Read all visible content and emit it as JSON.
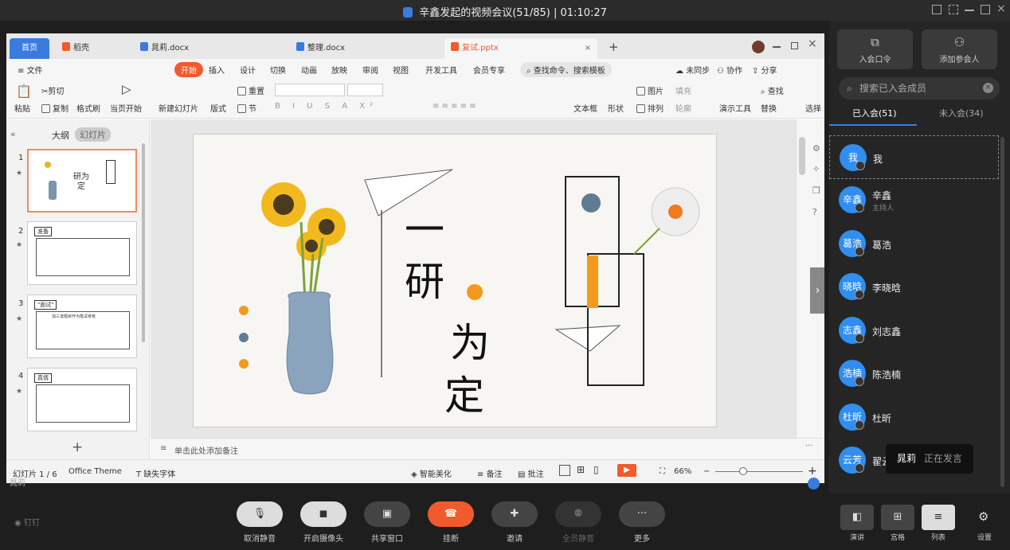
{
  "window": {
    "title": "辛鑫发起的视频会议(51/85)",
    "timer": "01:10:27"
  },
  "wps": {
    "tabs": [
      {
        "label": "首页"
      },
      {
        "label": "稻壳"
      },
      {
        "label": "晁莉.docx"
      },
      {
        "label": "整理.docx"
      },
      {
        "label": "复试.pptx"
      }
    ],
    "menu": [
      "文件",
      "开始",
      "插入",
      "设计",
      "切换",
      "动画",
      "放映",
      "审阅",
      "视图",
      "开发工具",
      "会员专享"
    ],
    "menu_search": "查找命令、搜索模板",
    "menu_right": [
      "未同步",
      "协作",
      "分享"
    ],
    "ribbon": {
      "paste": "粘贴",
      "cut": "剪切",
      "copy": "复制",
      "format_painter": "格式刷",
      "from_start": "当页开始",
      "new_slide": "新建幻灯片",
      "layout": "版式",
      "section": "节",
      "reset": "重置",
      "textbox": "文本框",
      "shape": "形状",
      "arrange": "排列",
      "picture": "图片",
      "fill": "填充",
      "outline": "轮廓",
      "presenter": "演示工具",
      "find": "查找",
      "replace": "替换",
      "select": "选择"
    },
    "panel_tabs": {
      "outline": "大纲",
      "slides": "幻灯片"
    },
    "notes_placeholder": "单击此处添加备注",
    "status": {
      "slide_count": "幻灯片 1 / 6",
      "theme": "Office Theme",
      "missing_font": "缺失字体",
      "beautify": "智能美化",
      "notes": "备注",
      "comment": "批注",
      "zoom": "66%"
    },
    "slides": [
      {
        "num": "1",
        "title": "研为定"
      },
      {
        "num": "2",
        "title": "准备"
      },
      {
        "num": "3",
        "title": "\"面试\"",
        "sub": "加三道题目作为笔试考核"
      },
      {
        "num": "4",
        "title": "真情"
      }
    ],
    "slide_text": {
      "c1": "一",
      "c2": "研",
      "c3": "为",
      "c4": "定"
    }
  },
  "sidebar": {
    "join_link": "入会口令",
    "add_member": "添加参会人",
    "search_placeholder": "搜索已入会成员",
    "tab_joined": "已入会(51)",
    "tab_not_joined": "未入会(34)",
    "members": [
      {
        "avatar": "我",
        "name": "我",
        "role": ""
      },
      {
        "avatar": "辛鑫",
        "name": "辛鑫",
        "role": "主持人"
      },
      {
        "avatar": "葛浩",
        "name": "葛浩",
        "role": ""
      },
      {
        "avatar": "晓晗",
        "name": "李晓晗",
        "role": ""
      },
      {
        "avatar": "志鑫",
        "name": "刘志鑫",
        "role": ""
      },
      {
        "avatar": "浩楠",
        "name": "陈浩楠",
        "role": ""
      },
      {
        "avatar": "杜昕",
        "name": "杜昕",
        "role": ""
      },
      {
        "avatar": "云芳",
        "name": "翟云",
        "role": ""
      }
    ],
    "speaking_name": "晁莉",
    "speaking_status": "正在发言"
  },
  "toolbar": {
    "presenter_name": "晁莉",
    "brand": "钉钉",
    "unmute": "取消静音",
    "camera": "开启摄像头",
    "share": "共享窗口",
    "hangup": "挂断",
    "invite": "邀请",
    "mute_all": "全员静音",
    "more": "更多",
    "views": [
      "演讲",
      "宫格",
      "列表"
    ],
    "settings": "设置"
  },
  "colors": {
    "accent": "#3a7be0",
    "hangup": "#f05a2c",
    "wps_start": "#f05a2c",
    "avatar": "#2f8ef0"
  }
}
